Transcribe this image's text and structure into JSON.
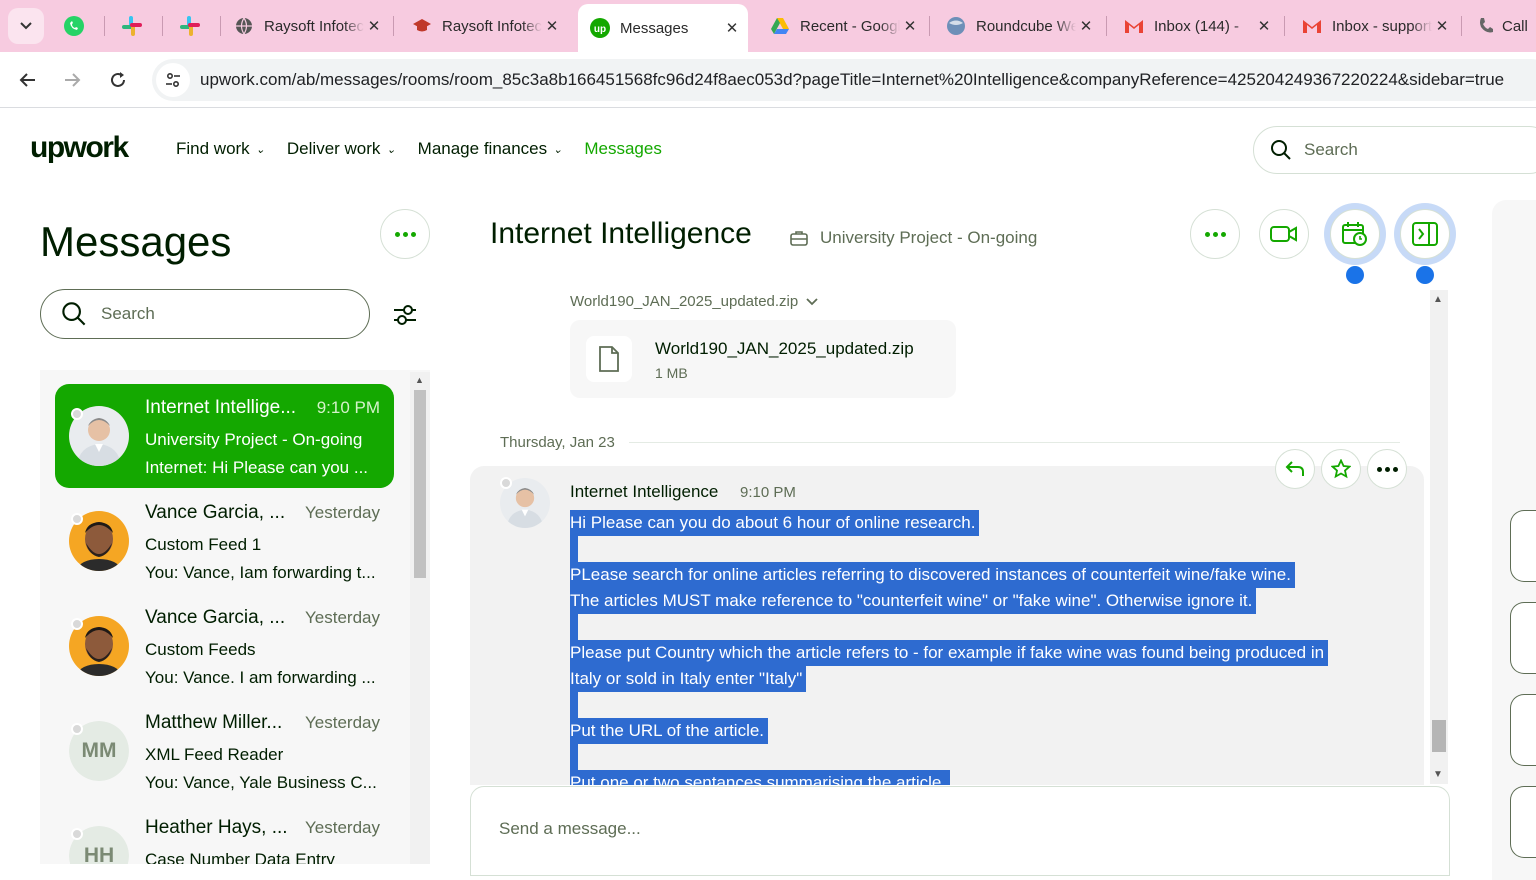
{
  "browser": {
    "tabs": [
      {
        "label": "",
        "icon": "whatsapp-icon",
        "pinned": true
      },
      {
        "label": "",
        "icon": "slack-icon",
        "pinned": true
      },
      {
        "label": "",
        "icon": "slack-icon",
        "pinned": true
      },
      {
        "label": "Raysoft Infotec",
        "icon": "globe-icon"
      },
      {
        "label": "Raysoft Infotec",
        "icon": "graduation-icon"
      },
      {
        "label": "Messages",
        "icon": "upwork-icon",
        "active": true
      },
      {
        "label": "Recent - Google",
        "icon": "google-drive-icon"
      },
      {
        "label": "Roundcube Webmail",
        "icon": "roundcube-icon"
      },
      {
        "label": "Inbox (144) -",
        "icon": "gmail-icon"
      },
      {
        "label": "Inbox - support",
        "icon": "gmail-icon"
      },
      {
        "label": "Call",
        "icon": "phone-icon"
      }
    ],
    "url": "upwork.com/ab/messages/rooms/room_85c3a8b166451568fc96d24f8aec053d?pageTitle=Internet%20Intelligence&companyReference=425204249367220224&sidebar=true"
  },
  "header": {
    "logo": "upwork",
    "nav": [
      {
        "label": "Find work",
        "dropdown": true
      },
      {
        "label": "Deliver work",
        "dropdown": true
      },
      {
        "label": "Manage finances",
        "dropdown": true
      },
      {
        "label": "Messages",
        "dropdown": false,
        "active": true
      }
    ],
    "search_placeholder": "Search"
  },
  "sidebar": {
    "title": "Messages",
    "search_placeholder": "Search",
    "rooms": [
      {
        "name": "Internet Intellige...",
        "time": "9:10 PM",
        "subtitle": "University Project - On-going",
        "preview": "Internet: Hi Please can you ...",
        "avatar": "photo-man-grey",
        "active": true
      },
      {
        "name": "Vance Garcia, ...",
        "time": "Yesterday",
        "subtitle": "Custom Feed 1",
        "preview": "You: Vance, Iam forwarding t...",
        "avatar": "photo-man-beard"
      },
      {
        "name": "Vance Garcia, ...",
        "time": "Yesterday",
        "subtitle": "Custom Feeds",
        "preview": "You: Vance. I am forwarding ...",
        "avatar": "photo-man-beard"
      },
      {
        "name": "Matthew Miller...",
        "time": "Yesterday",
        "subtitle": "XML Feed Reader",
        "preview": "You: Vance, Yale Business C...",
        "avatar": "initials",
        "initials": "MM"
      },
      {
        "name": "Heather Hays, ...",
        "time": "Yesterday",
        "subtitle": "Case Number Data Entry",
        "preview": "",
        "avatar": "initials",
        "initials": "HH"
      }
    ]
  },
  "conversation": {
    "title": "Internet Intelligence",
    "subtitle": "University Project - On-going",
    "attachment": {
      "label": "World190_JAN_2025_updated.zip",
      "file_name": "World190_JAN_2025_updated.zip",
      "file_size": "1 MB"
    },
    "date_separator": "Thursday, Jan 23",
    "message": {
      "sender": "Internet Intelligence",
      "time": "9:10 PM",
      "lines": [
        "Hi Please can you do about 6 hour of online research.",
        "",
        "PLease search for online articles referring to discovered instances of counterfeit wine/fake wine.",
        "The articles MUST make reference to \"counterfeit wine\" or \"fake wine\". Otherwise ignore it.",
        "",
        "Please put Country which the article refers to - for example if fake wine was found being produced in",
        "Italy or sold in Italy enter \"Italy\"",
        "",
        "Put the URL of the article.",
        "",
        "Put one or two sentances summarising the article."
      ]
    },
    "composer_placeholder": "Send a message..."
  }
}
